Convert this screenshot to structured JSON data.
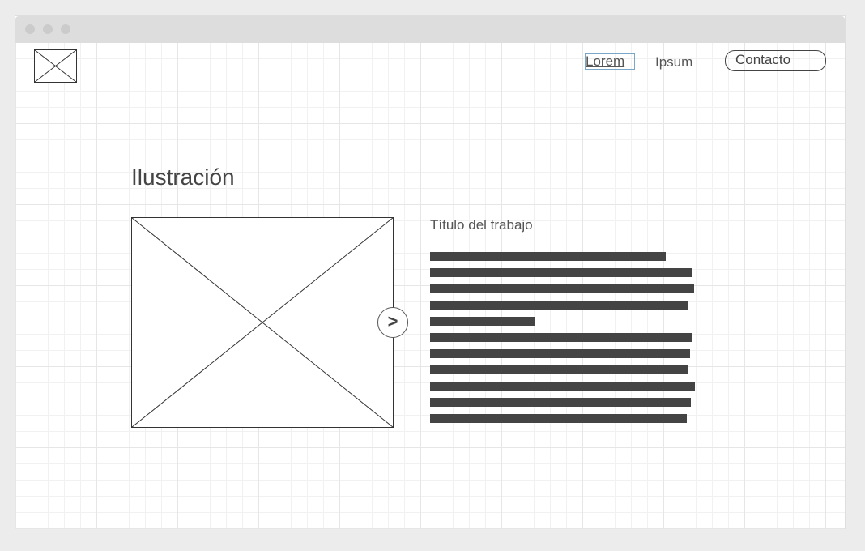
{
  "nav": {
    "items": [
      "Lorem",
      "Ipsum"
    ],
    "contact_label": "Contacto"
  },
  "main": {
    "section_title": "Ilustración",
    "work_title": "Título del trabajo",
    "next_label": ">"
  }
}
